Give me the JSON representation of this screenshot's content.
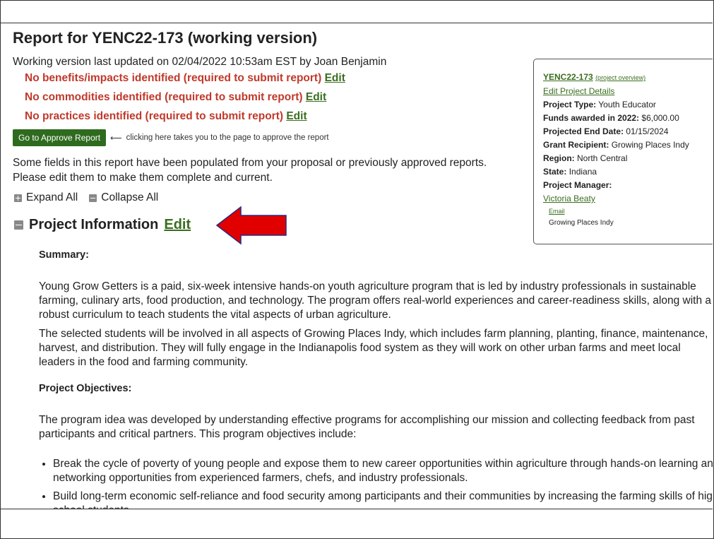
{
  "page": {
    "title": "Report for YENC22-173 (working version)",
    "updated": "Working version last updated on 02/04/2022 10:53am EST by Joan Benjamin"
  },
  "warnings": [
    {
      "text": "No benefits/impacts identified (required to submit report)",
      "edit": "Edit"
    },
    {
      "text": "No commodities identified (required to submit report)",
      "edit": "Edit"
    },
    {
      "text": "No practices identified (required to submit report)",
      "edit": "Edit"
    }
  ],
  "approve": {
    "button": "Go to Approve Report",
    "hint": "clicking here takes you to the page to approve the report"
  },
  "note": "Some fields in this report have been populated from your proposal or previously approved reports. Please edit them to make them complete and current.",
  "toggles": {
    "expand": "Expand All",
    "collapse": "Collapse All"
  },
  "section": {
    "title": "Project Information",
    "edit": "Edit",
    "summary_label": "Summary:",
    "summary_p1": "Young Grow Getters is a paid, six-week intensive hands-on youth agriculture program that is led by industry professionals in sustainable farming, culinary arts, food production, and technology. The program offers real-world experiences and career-readiness skills, along with a robust curriculum to teach students the vital aspects of urban agriculture.",
    "summary_p2": "The selected students will be involved in all aspects of Growing Places Indy, which includes farm planning, planting, finance, maintenance, harvest, and distribution. They will fully engage in the Indianapolis food system as they will work on other urban farms and meet local leaders in the food and farming community.",
    "objectives_label": "Project Objectives:",
    "objectives_intro": "The program idea was developed by understanding effective programs for accomplishing our mission and collecting feedback from past participants and critical partners. This program objectives include:",
    "objectives": [
      "Break the cycle of poverty of young people and expose them to new career opportunities within agriculture through hands-on learning and networking opportunities from experienced farmers, chefs, and industry professionals.",
      "Build long-term economic self-reliance and food security among participants and their communities by increasing the farming skills of high school students."
    ]
  },
  "sidebar": {
    "project_id": "YENC22-173",
    "overview_link": "(project overview)",
    "edit_details": "Edit Project Details",
    "type_label": "Project Type:",
    "type_value": "Youth Educator",
    "funds_label": "Funds awarded in 2022:",
    "funds_value": "$6,000.00",
    "end_label": "Projected End Date:",
    "end_value": "01/15/2024",
    "recipient_label": "Grant Recipient:",
    "recipient_value": "Growing Places Indy",
    "region_label": "Region:",
    "region_value": "North Central",
    "state_label": "State:",
    "state_value": "Indiana",
    "manager_label": "Project Manager:",
    "manager_name": "Victoria Beaty",
    "manager_email": "Email",
    "manager_org": "Growing Places Indy"
  },
  "colors": {
    "accent_green": "#2f6b1f",
    "warning_red": "#c0392b",
    "arrow_red": "#e00000"
  }
}
